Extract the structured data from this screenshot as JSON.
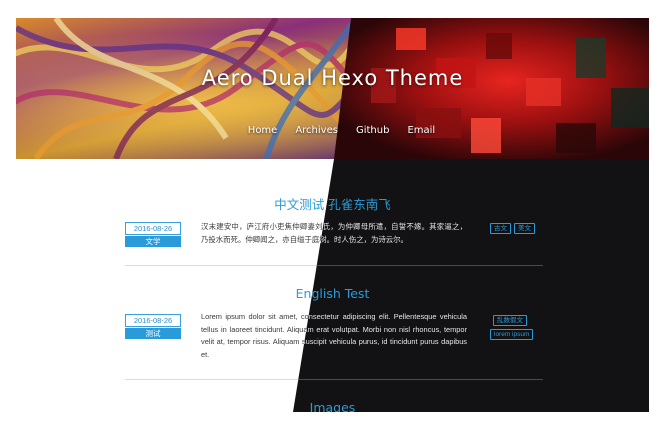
{
  "site": {
    "title": "Aero Dual Hexo Theme",
    "nav": [
      "Home",
      "Archives",
      "Github",
      "Email"
    ]
  },
  "posts": [
    {
      "title": "中文测试 孔雀东南飞",
      "date": "2016-08-26",
      "category": "文学",
      "excerpt": "汉末建安中，庐江府小吏焦仲卿妻刘氏，为仲卿母所遣，自誓不嫁。其家逼之，乃投水而死。仲卿闻之，亦自缢于庭树。时人伤之，为诗云尔。",
      "tags": [
        [
          "古文",
          "美文"
        ]
      ]
    },
    {
      "title": "English Test",
      "date": "2016-08-26",
      "category": "测试",
      "excerpt": "Lorem ipsum dolor sit amet, consectetur adipiscing elit. Pellentesque vehicula tellus in laoreet tincidunt. Aliquam erat volutpat. Morbi non nisl rhoncus, tempor velit at, tempor risus. Aliquam suscipit vehicula purus, id tincidunt purus dapibus et.",
      "tags": [
        [
          "乱数假文"
        ],
        [
          "lorem ipsum"
        ]
      ]
    },
    {
      "title": "Images"
    }
  ],
  "colors": {
    "accent": "#2a9bd8",
    "dark_bg": "#121214",
    "light_bg": "#ffffff"
  }
}
